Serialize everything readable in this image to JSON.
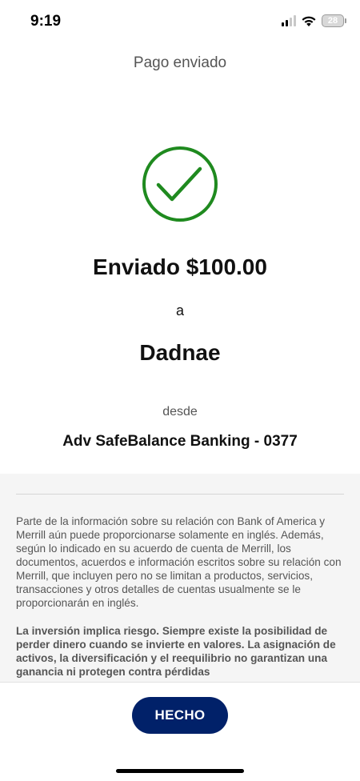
{
  "status_bar": {
    "time": "9:19",
    "battery": "28",
    "icons": [
      "cellular-signal-icon",
      "wifi-icon",
      "battery-icon"
    ]
  },
  "screen": {
    "title": "Pago enviado",
    "success_icon": "check-circle-icon",
    "success_color": "#1f8a1f"
  },
  "payment": {
    "sent_amount": "Enviado $100.00",
    "to_label": "a",
    "recipient": "Dadnae",
    "from_label": "desde",
    "from_account": "Adv SafeBalance Banking - 0377"
  },
  "disclosure": {
    "paragraph": "Parte de la información sobre su relación con Bank of America y Merrill aún puede proporcionarse solamente en inglés. Además, según lo indicado en su acuerdo de cuenta de Merrill, los documentos, acuerdos e información escritos sobre su relación con Merrill, que incluyen pero no se limitan a productos, servicios, transacciones y otros detalles de cuentas usualmente se le proporcionarán en inglés.",
    "risk_paragraph": "La inversión implica riesgo. Siempre existe la posibilidad de perder dinero cuando se invierte en valores. La asignación de activos, la diversificación y el reequilibrio no garantizan una ganancia ni protegen contra pérdidas"
  },
  "footer": {
    "done_label": "HECHO",
    "done_color": "#012169"
  }
}
